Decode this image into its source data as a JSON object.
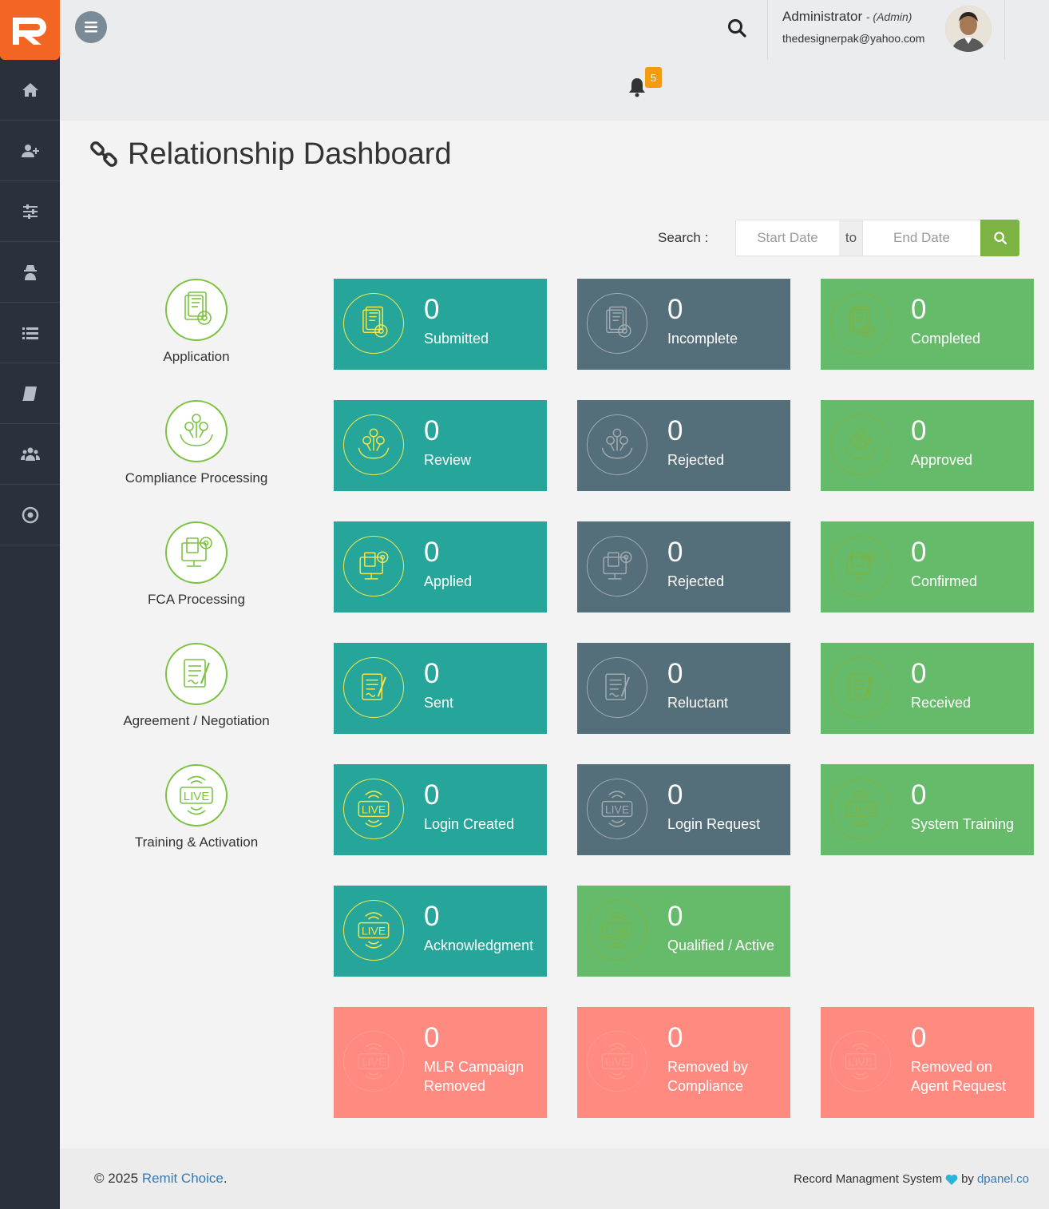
{
  "header": {
    "user_name": "Administrator",
    "user_role": "- (Admin)",
    "user_email": "thedesignerpak@yahoo.com",
    "notification_count": "5"
  },
  "sidebar": {
    "items": [
      {
        "icon": "home-icon"
      },
      {
        "icon": "user-plus-icon"
      },
      {
        "icon": "sliders-icon"
      },
      {
        "icon": "user-secret-icon"
      },
      {
        "icon": "list-icon"
      },
      {
        "icon": "book-icon"
      },
      {
        "icon": "users-icon"
      },
      {
        "icon": "dot-circle-icon"
      }
    ]
  },
  "page": {
    "title": "Relationship Dashboard"
  },
  "search": {
    "label": "Search :",
    "start_placeholder": "Start Date",
    "to_label": "to",
    "end_placeholder": "End Date"
  },
  "categories": [
    {
      "label": "Application",
      "icon": "application-icon"
    },
    {
      "label": "Compliance Processing",
      "icon": "compliance-icon"
    },
    {
      "label": "FCA Processing",
      "icon": "fca-icon"
    },
    {
      "label": "Agreement / Negotiation",
      "icon": "agreement-icon"
    },
    {
      "label": "Training & Activation",
      "icon": "live-icon"
    }
  ],
  "cards": {
    "submitted": {
      "value": "0",
      "label": "Submitted"
    },
    "incomplete": {
      "value": "0",
      "label": "Incomplete"
    },
    "completed": {
      "value": "0",
      "label": "Completed"
    },
    "review": {
      "value": "0",
      "label": "Review"
    },
    "rejected_compliance": {
      "value": "0",
      "label": "Rejected"
    },
    "approved": {
      "value": "0",
      "label": "Approved"
    },
    "applied": {
      "value": "0",
      "label": "Applied"
    },
    "rejected_fca": {
      "value": "0",
      "label": "Rejected"
    },
    "confirmed": {
      "value": "0",
      "label": "Confirmed"
    },
    "sent": {
      "value": "0",
      "label": "Sent"
    },
    "reluctant": {
      "value": "0",
      "label": "Reluctant"
    },
    "received": {
      "value": "0",
      "label": "Received"
    },
    "login_created": {
      "value": "0",
      "label": "Login Created"
    },
    "login_request": {
      "value": "0",
      "label": "Login Request"
    },
    "system_training": {
      "value": "0",
      "label": "System Training"
    },
    "acknowledgment": {
      "value": "0",
      "label": "Acknowledgment"
    },
    "qualified_active": {
      "value": "0",
      "label": "Qualified / Active"
    },
    "mlr_removed": {
      "value": "0",
      "label": "MLR Campaign Removed"
    },
    "removed_compliance": {
      "value": "0",
      "label": "Removed by Compliance"
    },
    "removed_agent": {
      "value": "0",
      "label": "Removed on Agent Request"
    }
  },
  "colors": {
    "teal": "#26a69a",
    "slate": "#546e7a",
    "green": "#66bb6a",
    "salmon": "#ff8a80",
    "brand": "#f26522"
  },
  "footer": {
    "copyright": "© 2025",
    "company_link": "Remit Choice",
    "period": ".",
    "system_label": "Record Managment System",
    "by_label": "by",
    "credit_link": "dpanel.co"
  }
}
